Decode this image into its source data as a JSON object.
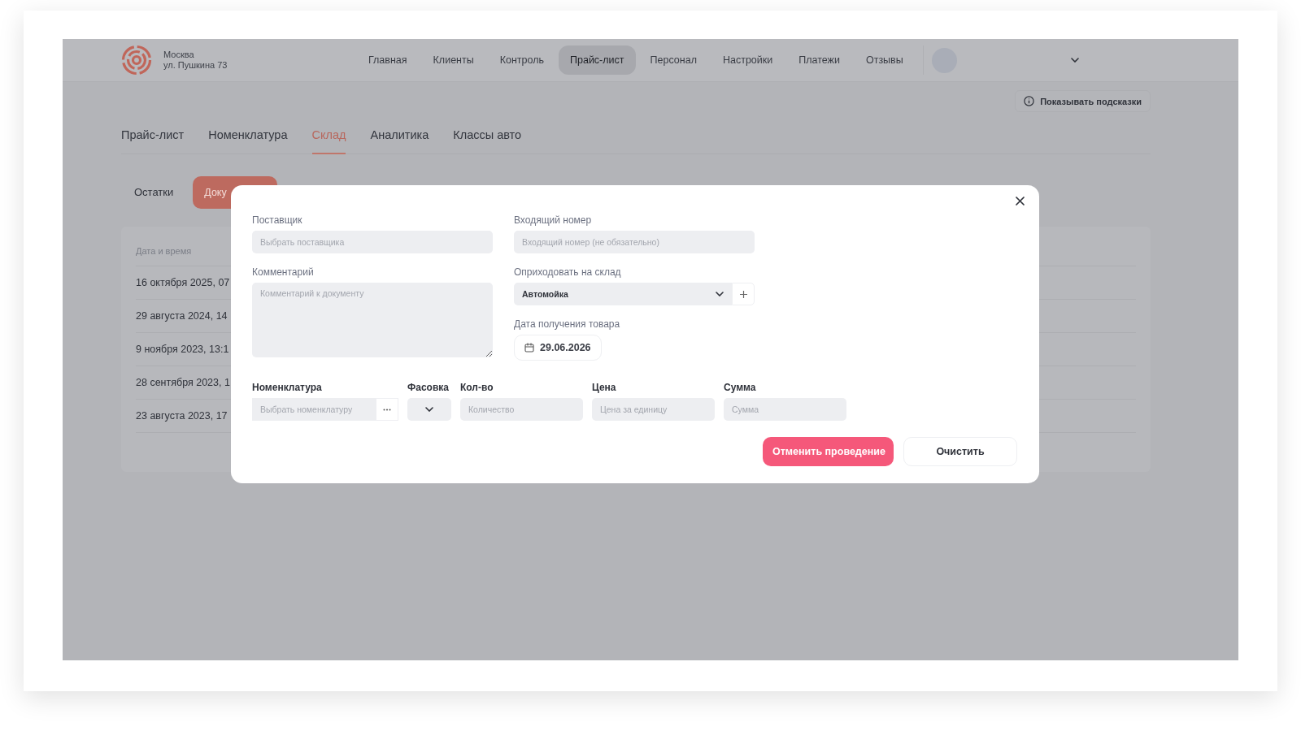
{
  "location": {
    "city": "Москва",
    "address": "ул. Пушкина 73"
  },
  "nav": [
    {
      "label": "Главная",
      "selected": false
    },
    {
      "label": "Клиенты",
      "selected": false
    },
    {
      "label": "Контроль",
      "selected": false
    },
    {
      "label": "Прайс-лист",
      "selected": true
    },
    {
      "label": "Персонал",
      "selected": false
    },
    {
      "label": "Настройки",
      "selected": false
    },
    {
      "label": "Платежи",
      "selected": false
    },
    {
      "label": "Отзывы",
      "selected": false
    }
  ],
  "hints_button": "Показывать подсказки",
  "tabs": [
    {
      "label": "Прайс-лист",
      "selected": false
    },
    {
      "label": "Номенклатура",
      "selected": false
    },
    {
      "label": "Склад",
      "selected": true
    },
    {
      "label": "Аналитика",
      "selected": false
    },
    {
      "label": "Классы авто",
      "selected": false
    }
  ],
  "subtabs": [
    {
      "label": "Остатки",
      "selected": false
    },
    {
      "label": "Доку",
      "selected": true
    }
  ],
  "table": {
    "columns": [
      "Дата и время"
    ],
    "rows": [
      [
        "16 октября 2025, 07"
      ],
      [
        "29 августа 2024, 14"
      ],
      [
        "9 ноября 2023, 13:1"
      ],
      [
        "28 сентября 2023, 1"
      ],
      [
        "23 августа 2023, 17"
      ]
    ]
  },
  "modal": {
    "supplier": {
      "label": "Поставщик",
      "placeholder": "Выбрать поставщика"
    },
    "incoming_number": {
      "label": "Входящий номер",
      "placeholder": "Входящий номер (не обязательно)"
    },
    "comment": {
      "label": "Комментарий",
      "placeholder": "Комментарий к документу"
    },
    "warehouse": {
      "label": "Оприходовать на склад",
      "value": "Автомойка"
    },
    "receipt_date": {
      "label": "Дата получения товара",
      "value": "29.06.2026"
    },
    "item_columns": [
      {
        "label": "Номенклатура",
        "kind": "picker",
        "placeholder": "Выбрать номенклатуру"
      },
      {
        "label": "Фасовка",
        "kind": "select"
      },
      {
        "label": "Кол-во",
        "kind": "input",
        "placeholder": "Количество"
      },
      {
        "label": "Цена",
        "kind": "input",
        "placeholder": "Цена за единицу"
      },
      {
        "label": "Сумма",
        "kind": "input",
        "placeholder": "Сумма"
      }
    ],
    "buttons": [
      {
        "label": "Отменить проведение",
        "kind": "primary"
      },
      {
        "label": "Очистить",
        "kind": "secondary"
      }
    ]
  }
}
